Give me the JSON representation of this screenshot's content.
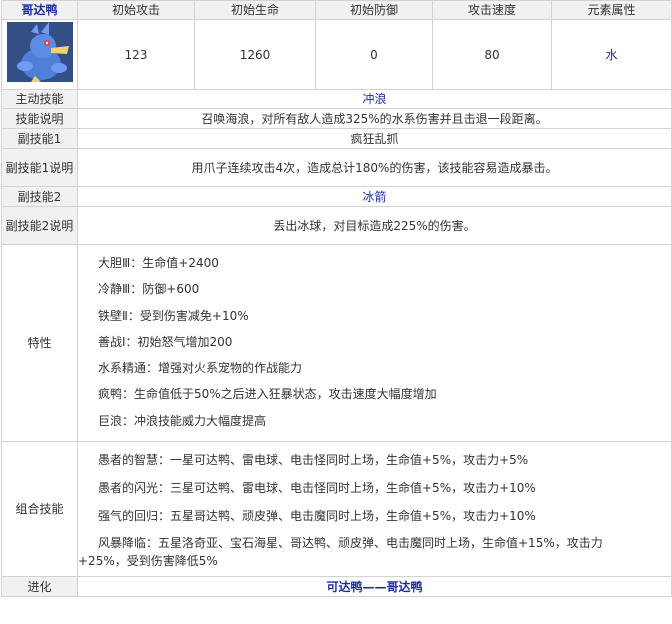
{
  "header": {
    "name": "哥达鸭",
    "cols": [
      "初始攻击",
      "初始生命",
      "初始防御",
      "攻击速度",
      "元素属性"
    ]
  },
  "stats": {
    "attack": "123",
    "hp": "1260",
    "defense": "0",
    "speed": "80",
    "element": "水"
  },
  "colors": {
    "title_blue": "#1f2d9c",
    "border": "#d2d2d2",
    "label_bg": "#f1f1f1"
  },
  "rows": {
    "active_skill": {
      "label": "主动技能",
      "value": "冲浪"
    },
    "skill_desc": {
      "label": "技能说明",
      "value": "召唤海浪，对所有敌人造成325%的水系伤害并且击退一段距离。"
    },
    "sub1": {
      "label": "副技能1",
      "value": "疯狂乱抓"
    },
    "sub1_desc": {
      "label": "副技能1说明",
      "value": "用爪子连续攻击4次，造成总计180%的伤害，该技能容易造成暴击。"
    },
    "sub2": {
      "label": "副技能2",
      "value": "冰箭"
    },
    "sub2_desc": {
      "label": "副技能2说明",
      "value": "丢出冰球，对目标造成225%的伤害。"
    },
    "traits": {
      "label": "特性",
      "items": [
        "大胆Ⅲ：生命值+2400",
        "冷静Ⅲ：防御+600",
        "铁壁Ⅱ：受到伤害减免+10%",
        "善战Ⅰ：初始怒气增加200",
        "水系精通：增强对火系宠物的作战能力",
        "疯鸭：生命值低于50%之后进入狂暴状态，攻击速度大幅度增加",
        "巨浪：冲浪技能威力大幅度提高"
      ]
    },
    "combos": {
      "label": "组合技能",
      "items": [
        "愚者的智慧：一星可达鸭、雷电球、电击怪同时上场，生命值+5%，攻击力+5%",
        "愚者的闪光：三星可达鸭、雷电球、电击怪同时上场，生命值+5%，攻击力+10%",
        "强气的回归：五星哥达鸭、顽皮弹、电击魔同时上场，生命值+5%，攻击力+10%"
      ],
      "last_line1": "风暴降临：五星洛奇亚、宝石海星、哥达鸭、顽皮弹、电击魔同时上场，生命值+15%，攻击力",
      "last_line2": "+25%，受到伤害降低5%"
    },
    "evolution": {
      "label": "进化",
      "value": "可达鸭——哥达鸭"
    }
  },
  "icons": {
    "portrait": "golduck-portrait-icon"
  }
}
